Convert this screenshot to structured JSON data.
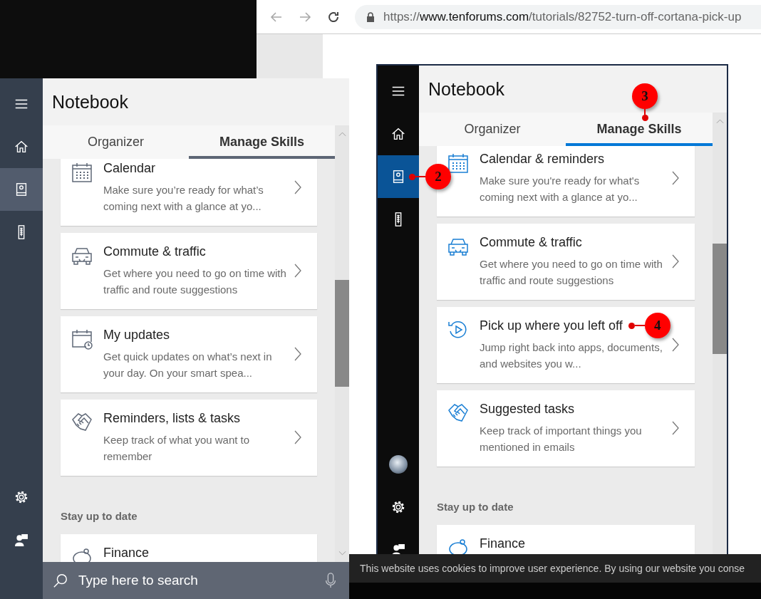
{
  "browser": {
    "url": {
      "scheme": "https://",
      "host": "www.tenforums.com",
      "path": "/tutorials/82752-turn-off-cortana-pick-up"
    }
  },
  "panels": [
    {
      "kind": "taskbar",
      "title": "Notebook",
      "nav": [
        {
          "kind": "menu",
          "selected": false
        },
        {
          "kind": "home",
          "selected": false
        },
        {
          "kind": "notebook",
          "selected": true
        },
        {
          "kind": "devices",
          "selected": false
        }
      ],
      "nav_bottom": [
        {
          "kind": "settings",
          "selected": false
        },
        {
          "kind": "feedback",
          "selected": false
        }
      ],
      "tabs": [
        {
          "label": "Organizer",
          "selected": false
        },
        {
          "label": "Manage Skills",
          "selected": true
        }
      ],
      "sections": [
        {
          "cards": [
            {
              "kind": "calendar",
              "title": "Calendar",
              "description": "Make sure you’re ready for what’s coming next with a glance at yo..."
            },
            {
              "kind": "car",
              "title": "Commute & traffic",
              "description": "Get where you need to go on time with traffic and route suggestions"
            },
            {
              "kind": "calendar-clock",
              "title": "My updates",
              "description": "Get quick updates on what’s next in your day. On your smart spea..."
            },
            {
              "kind": "handshake",
              "title": "Reminders, lists & tasks",
              "description": "Keep track of what you want to remember"
            }
          ]
        },
        {
          "heading": "Stay up to date",
          "cards": [
            {
              "kind": "piggy",
              "title": "Finance"
            }
          ]
        }
      ],
      "search": {
        "placeholder": "Type here to search"
      }
    },
    {
      "kind": "screenshot",
      "title": "Notebook",
      "nav": [
        {
          "kind": "menu",
          "selected": false
        },
        {
          "kind": "home",
          "selected": false
        },
        {
          "kind": "notebook",
          "selected": true,
          "callout": "2"
        },
        {
          "kind": "devices",
          "selected": false
        }
      ],
      "nav_bottom": [
        {
          "kind": "avatar",
          "selected": false
        },
        {
          "kind": "settings",
          "selected": false
        },
        {
          "kind": "feedback",
          "selected": false
        }
      ],
      "tabs": [
        {
          "label": "Organizer",
          "selected": false
        },
        {
          "label": "Manage Skills",
          "selected": true,
          "callout": "3"
        }
      ],
      "sections": [
        {
          "cards": [
            {
              "kind": "calendar",
              "title": "Calendar & reminders",
              "description": "Make sure you're ready for what's coming next with a glance at yo..."
            },
            {
              "kind": "car",
              "title": "Commute & traffic",
              "description": "Get where you need to go on time with traffic and route suggestions"
            },
            {
              "kind": "replay",
              "title": "Pick up where you left off",
              "description": "Jump right back into apps, documents, and websites you w...",
              "callout": "4"
            },
            {
              "kind": "handshake",
              "title": "Suggested tasks",
              "description": "Keep track of important things you mentioned in emails"
            }
          ]
        },
        {
          "heading": "Stay up to date",
          "cards": [
            {
              "kind": "piggy",
              "title": "Finance"
            }
          ]
        }
      ]
    }
  ],
  "cookie_bar": {
    "text": "This website uses cookies to improve user experience. By using our website you conse"
  }
}
